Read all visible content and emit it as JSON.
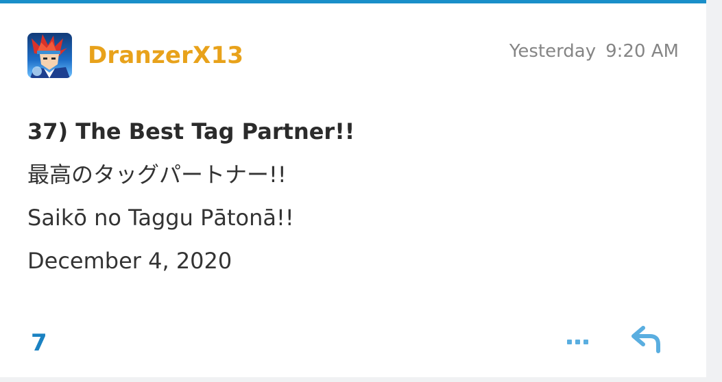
{
  "post": {
    "username": "DranzerX13",
    "avatar_icon": "anime-character-avatar",
    "timestamp_day": "Yesterday",
    "timestamp_time": "9:20 AM",
    "body": {
      "title": "37) The Best Tag Partner!!",
      "japanese": "最高のタッグパートナー!!",
      "romaji": "Saikō no Taggu Pātonā!!",
      "date": "December 4, 2020"
    },
    "footer": {
      "like_count": "7",
      "more_icon": "ellipsis-icon",
      "reply_icon": "reply-arrow-icon"
    }
  },
  "colors": {
    "accent": "#1a8fc9",
    "username": "#e8a21b",
    "link_blue": "#1b82c2"
  }
}
